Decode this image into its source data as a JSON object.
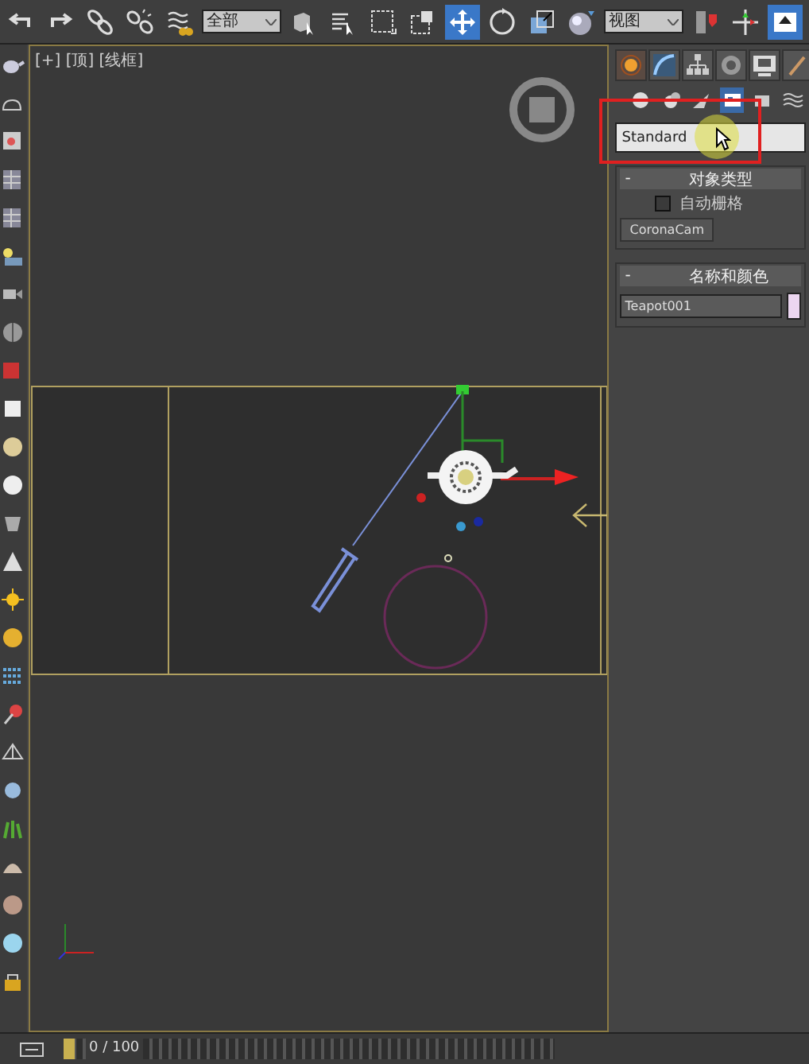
{
  "toolbar": {
    "items": [
      {
        "kind": "undo",
        "selected": false
      },
      {
        "kind": "redo",
        "selected": false
      },
      {
        "kind": "link",
        "selected": false
      },
      {
        "kind": "unlink",
        "selected": false
      },
      {
        "kind": "bind",
        "selected": false
      },
      {
        "kind": "dropdown",
        "value": "全部",
        "selected": false
      },
      {
        "kind": "select",
        "selected": false
      },
      {
        "kind": "select-name",
        "selected": false
      },
      {
        "kind": "region",
        "selected": false
      },
      {
        "kind": "crossing",
        "selected": false
      },
      {
        "kind": "move",
        "selected": true
      },
      {
        "kind": "rotate",
        "selected": false
      },
      {
        "kind": "scale",
        "selected": false
      },
      {
        "kind": "place",
        "selected": false
      },
      {
        "kind": "dropdown",
        "value": "视图",
        "selected": false
      },
      {
        "kind": "pin",
        "selected": false
      },
      {
        "kind": "axis",
        "selected": false
      },
      {
        "kind": "snap",
        "selected": true
      }
    ]
  },
  "viewport": {
    "label": "[+] [顶] [线框]"
  },
  "command_panel": {
    "tabs": [
      {
        "kind": "create",
        "selected": true
      },
      {
        "kind": "modify",
        "selected": false
      },
      {
        "kind": "hierarchy",
        "selected": false
      },
      {
        "kind": "motion",
        "selected": false
      },
      {
        "kind": "display",
        "selected": false
      },
      {
        "kind": "utilities",
        "selected": false
      }
    ],
    "categories": [
      {
        "kind": "geometry",
        "selected": false
      },
      {
        "kind": "shapes",
        "selected": false
      },
      {
        "kind": "lights",
        "selected": false
      },
      {
        "kind": "cameras",
        "selected": true
      },
      {
        "kind": "helpers",
        "selected": false
      },
      {
        "kind": "spacewarps",
        "selected": false
      }
    ],
    "dropdown": {
      "value": "Standard"
    },
    "rollouts": [
      {
        "kind": "object_type",
        "toggle": "-",
        "title": "对象类型",
        "checkbox": {
          "label": "自动栅格",
          "checked": false
        },
        "buttons": [
          "CoronaCam"
        ]
      },
      {
        "kind": "name_color",
        "toggle": "-",
        "title": "名称和颜色",
        "name": "Teapot001",
        "color": "#ecd6f0"
      }
    ]
  },
  "timeline": {
    "frame": "0 / 100",
    "level": 0
  }
}
